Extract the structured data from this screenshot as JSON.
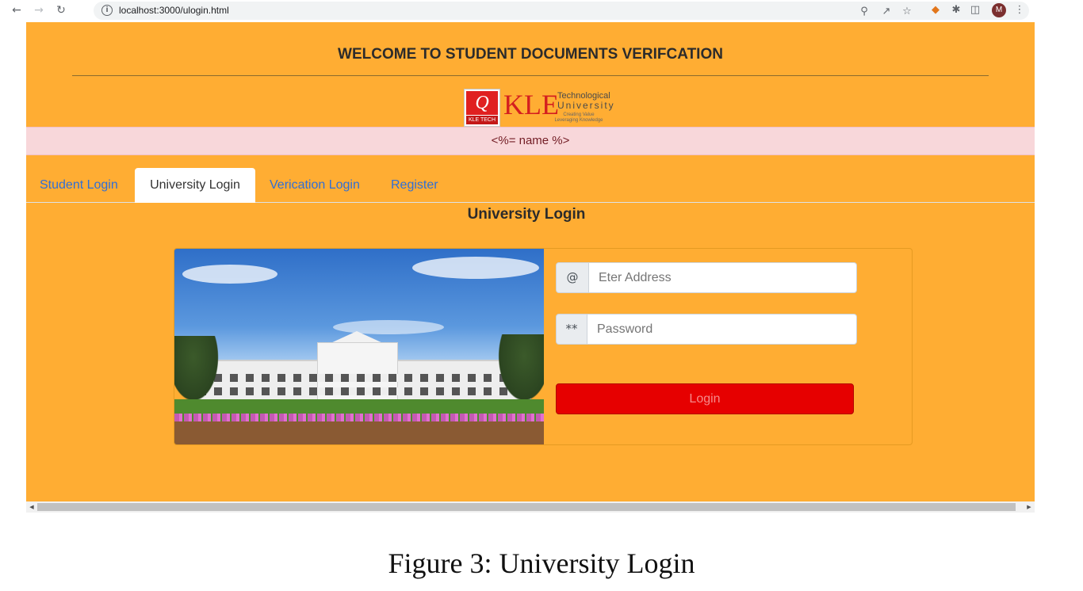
{
  "browser": {
    "url": "localhost:3000/ulogin.html",
    "back_icon": "arrow-left-icon",
    "forward_icon": "arrow-right-icon",
    "reload_icon": "reload-icon",
    "avatar_initial": "M"
  },
  "header": {
    "welcome": "WELCOME TO STUDENT DOCUMENTS VERIFCATION"
  },
  "logo": {
    "mark_text": "KLE TECH",
    "kle": "KLE",
    "line1": "Technological",
    "line2": "University",
    "tagline1": "Creating Value",
    "tagline2": "Leveraging Knowledge"
  },
  "alert": {
    "text": "<%= name %>"
  },
  "tabs": [
    {
      "label": "Student Login"
    },
    {
      "label": "University Login"
    },
    {
      "label": "Verication Login"
    },
    {
      "label": "Register"
    }
  ],
  "login": {
    "title": "University Login",
    "email_addon": "@",
    "email_placeholder": "Eter Address",
    "password_addon": "**",
    "password_placeholder": "Password",
    "button": "Login"
  },
  "caption": "Figure 3: University Login",
  "colors": {
    "page_bg": "#ffad33",
    "alert_bg": "#f8d7da",
    "button_bg": "#e60000",
    "tab_link": "#2f6fd6"
  }
}
